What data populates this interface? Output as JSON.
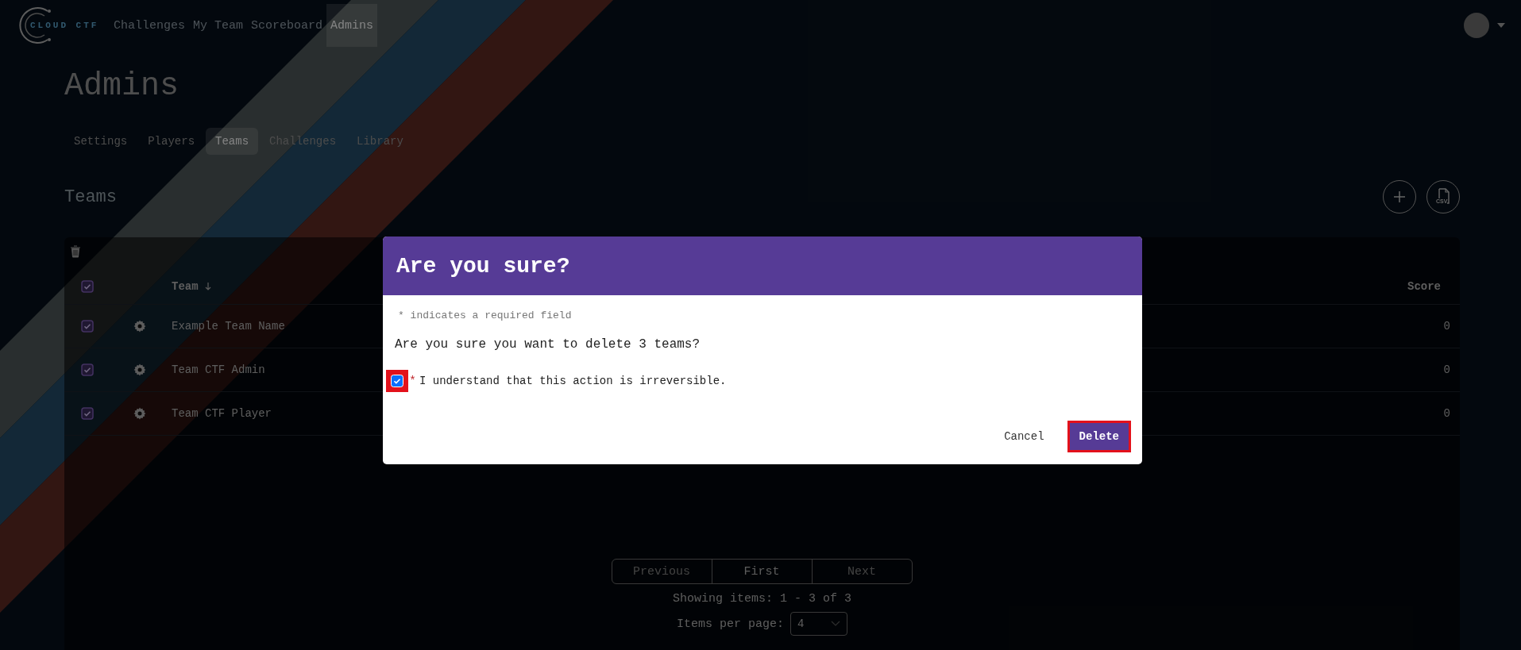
{
  "navbar": {
    "logo_text": "CLOUD CTF",
    "links": [
      {
        "label": "Challenges",
        "selected": false
      },
      {
        "label": "My Team",
        "selected": false
      },
      {
        "label": "Scoreboard",
        "selected": false
      },
      {
        "label": "Admins",
        "selected": true
      }
    ]
  },
  "page_title": "Admins",
  "admin_tabs": [
    {
      "label": "Settings",
      "selected": false
    },
    {
      "label": "Players",
      "selected": false
    },
    {
      "label": "Teams",
      "selected": true
    },
    {
      "label": "Challenges",
      "selected": false
    },
    {
      "label": "Library",
      "selected": false
    }
  ],
  "section": {
    "title": "Teams",
    "csv_label": "CSV"
  },
  "table": {
    "select_all_checked": true,
    "columns": [
      "Team",
      "Score"
    ],
    "rows": [
      {
        "checked": true,
        "team": "Example Team Name",
        "score": "0"
      },
      {
        "checked": true,
        "team": "Team CTF Admin",
        "score": "0"
      },
      {
        "checked": true,
        "team": "Team CTF Player",
        "score": "0"
      }
    ]
  },
  "pagination": {
    "buttons": [
      {
        "label": "Previous",
        "disabled": true
      },
      {
        "label": "First",
        "disabled": false
      },
      {
        "label": "Next",
        "disabled": true
      }
    ],
    "summary": "Showing items: 1 - 3 of 3",
    "per_page_label": "Items per page:",
    "per_page_value": "4"
  },
  "modal": {
    "title": "Are you sure?",
    "required_note": "* indicates a required field",
    "message": "Are you sure you want to delete 3 teams?",
    "confirm": {
      "checked": true,
      "highlighted": true,
      "required_mark": "*",
      "label": "I understand that this action is irreversible."
    },
    "buttons": [
      {
        "label": "Cancel",
        "kind": "secondary",
        "highlighted": false
      },
      {
        "label": "Delete",
        "kind": "primary",
        "highlighted": true
      }
    ]
  }
}
